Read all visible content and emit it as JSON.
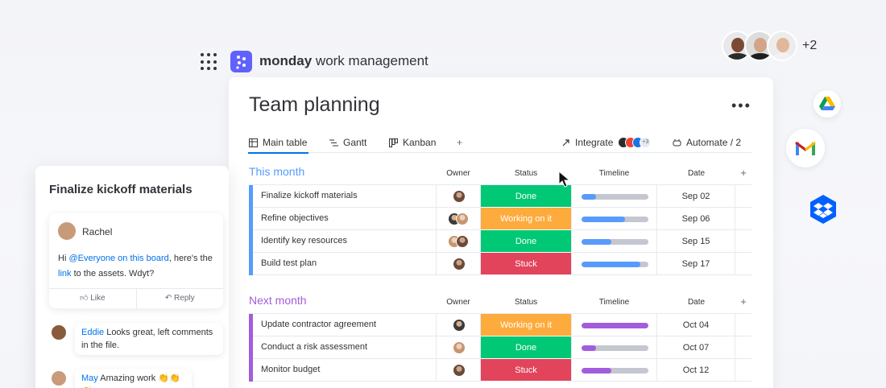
{
  "app": {
    "brand_bold": "monday",
    "brand_rest": " work management",
    "others_count": "+2"
  },
  "board": {
    "title": "Team planning",
    "more": "•••",
    "tabs": [
      {
        "label": "Main table",
        "icon": "table-icon"
      },
      {
        "label": "Gantt",
        "icon": "gantt-icon"
      },
      {
        "label": "Kanban",
        "icon": "kanban-icon"
      },
      {
        "label": "+",
        "icon": "add-view-icon"
      }
    ],
    "integrate_label": "Integrate",
    "integrate_more": "+3",
    "automate_label": "Automate / 2"
  },
  "columns": {
    "owner": "Owner",
    "status": "Status",
    "timeline": "Timeline",
    "date": "Date",
    "add": "+"
  },
  "groups": [
    {
      "title": "This month",
      "color": "#579bfc",
      "rows": [
        {
          "name": "Finalize kickoff materials",
          "status": "Done",
          "status_color": "#00c875",
          "timeline_progress": 0.22,
          "date": "Sep 02",
          "owners": 1
        },
        {
          "name": "Refine objectives",
          "status": "Working on it",
          "status_color": "#fdab3d",
          "timeline_progress": 0.65,
          "date": "Sep 06",
          "owners": 2
        },
        {
          "name": "Identify key resources",
          "status": "Done",
          "status_color": "#00c875",
          "timeline_progress": 0.45,
          "date": "Sep 15",
          "owners": 2
        },
        {
          "name": "Build test plan",
          "status": "Stuck",
          "status_color": "#e2445c",
          "timeline_progress": 0.88,
          "date": "Sep 17",
          "owners": 1
        }
      ]
    },
    {
      "title": "Next month",
      "color": "#a25ddc",
      "rows": [
        {
          "name": "Update contractor agreement",
          "status": "Working on it",
          "status_color": "#fdab3d",
          "timeline_progress": 1.0,
          "date": "Oct 04",
          "owners": 1
        },
        {
          "name": "Conduct a risk assessment",
          "status": "Done",
          "status_color": "#00c875",
          "timeline_progress": 0.22,
          "date": "Oct 07",
          "owners": 1
        },
        {
          "name": "Monitor budget",
          "status": "Stuck",
          "status_color": "#e2445c",
          "timeline_progress": 0.45,
          "date": "Oct 12",
          "owners": 1
        }
      ]
    }
  ],
  "chat": {
    "title": "Finalize kickoff materials",
    "author": "Rachel",
    "msg_1": "Hi ",
    "msg_mention": "@Everyone on this board",
    "msg_2": ", here's the ",
    "msg_link": "link",
    "msg_3": " to the assets. Wdyt?",
    "like_label": "Like",
    "reply_label": "Reply",
    "replies": [
      {
        "author": "Eddie",
        "text": " Looks great, left comments in the file."
      },
      {
        "author": "May",
        "text": " Amazing work 👏👏👏"
      }
    ]
  },
  "colors": {
    "accent": "#0073ea",
    "brand": "#6161ff",
    "done": "#00c875",
    "working": "#fdab3d",
    "stuck": "#e2445c"
  }
}
